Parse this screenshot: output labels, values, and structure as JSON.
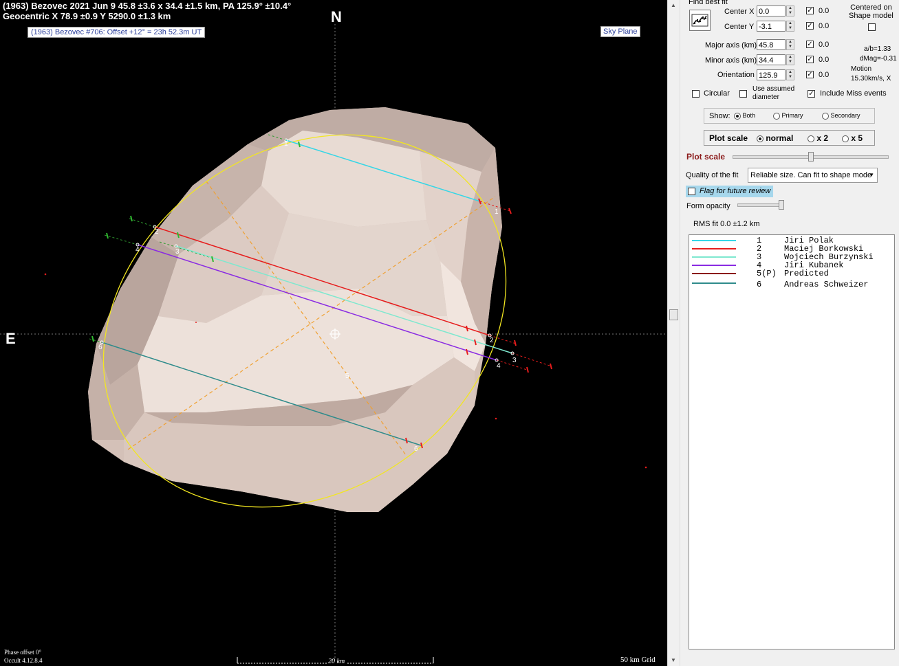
{
  "header": {
    "line1": "(1963) Bezovec  2021 Jun 9  45.8 ±3.6 x 34.4 ±1.5 km, PA 125.9° ±10.4°",
    "line2": "Geocentric  X  78.9 ±0.9  Y 5290.0 ±1.3 km"
  },
  "event_label": "(1963) Bezovec #706: Offset +12° = 23h 52.3m UT",
  "sky_plane_label": "Sky Plane",
  "compass": {
    "north": "N",
    "east": "E"
  },
  "footer": {
    "phase_offset": "Phase offset 0°",
    "version": "Occult 4.12.8.4",
    "scale_bar": "20 km",
    "grid": "50 km Grid"
  },
  "chord_labels": [
    "1",
    "2",
    "3",
    "4",
    "5",
    "6"
  ],
  "panel": {
    "find_best_fit": "Find best fit",
    "centered_on": "Centered on\nShape model",
    "center_x": {
      "label": "Center X",
      "value": "0.0",
      "checked": true,
      "uncertainty": "0.0"
    },
    "center_y": {
      "label": "Center Y",
      "value": "-3.1",
      "checked": true,
      "uncertainty": "0.0"
    },
    "major_axis": {
      "label": "Major axis (km)",
      "value": "45.8",
      "checked": true,
      "uncertainty": "0.0"
    },
    "minor_axis": {
      "label": "Minor axis (km)",
      "value": "34.4",
      "checked": true,
      "uncertainty": "0.0"
    },
    "orientation": {
      "label": "Orientation",
      "value": "125.9",
      "checked": true,
      "uncertainty": "0.0"
    },
    "ab_ratio": "a/b=1.33",
    "dmag": "dMag=-0.31",
    "motion_label": "Motion",
    "motion_value": "15.30km/s, X",
    "circular": "Circular",
    "use_assumed_diameter": "Use assumed\ndiameter",
    "include_miss": "Include Miss events",
    "show_label": "Show:",
    "show_options": [
      "Both",
      "Primary",
      "Secondary"
    ],
    "plot_scale_group_label": "Plot scale",
    "plot_scale_options": [
      "normal",
      "x 2",
      "x 5"
    ],
    "plot_scale_slider_label": "Plot scale",
    "quality_label": "Quality of the fit",
    "quality_value": "Reliable size. Can fit to shape mode",
    "flag_review": "Flag for future review",
    "form_opacity": "Form opacity",
    "rms_fit": "RMS fit 0.0 ±1.2 km"
  },
  "observers": [
    {
      "num": "1",
      "name": "Jiri Polak",
      "color": "#35d6e6"
    },
    {
      "num": "2",
      "name": "Maciej Borkowski",
      "color": "#e61c1c"
    },
    {
      "num": "3",
      "name": "Wojciech Burzynski",
      "color": "#7ee8cf"
    },
    {
      "num": "4",
      "name": "Jiri Kubanek",
      "color": "#8a2be2"
    },
    {
      "num": "5(P)",
      "name": "Predicted",
      "color": "#8b1a1a"
    },
    {
      "num": "6",
      "name": "Andreas Schweizer",
      "color": "#2e8b8b"
    }
  ],
  "colors": {
    "ellipse": "#f2e620",
    "axes": "#f0a030",
    "shape": "#d6c4bb"
  }
}
